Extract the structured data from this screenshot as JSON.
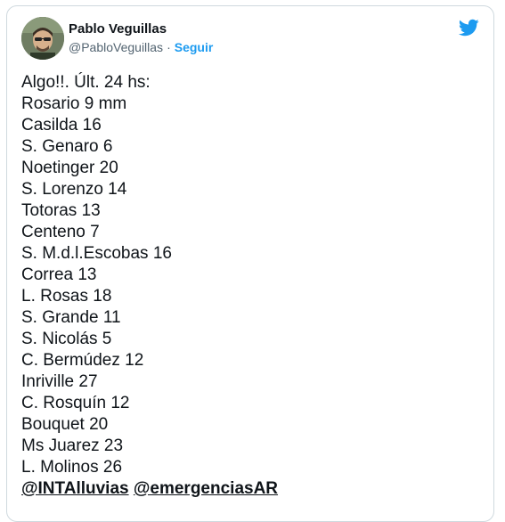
{
  "author": {
    "name": "Pablo Veguillas",
    "handle": "@PabloVeguillas",
    "separator": "·",
    "follow_label": "Seguir"
  },
  "icons": {
    "brand": "twitter-bird-icon",
    "brand_color": "#1d9bf0"
  },
  "tweet": {
    "lines": [
      "Algo!!. Últ. 24 hs:",
      "Rosario 9 mm",
      "Casilda 16",
      "S. Genaro 6",
      "Noetinger 20",
      "S. Lorenzo 14",
      "Totoras 13",
      "Centeno 7",
      "S. M.d.l.Escobas 16",
      "Correa 13",
      "L. Rosas 18",
      "S. Grande 11",
      "S. Nicolás 5",
      "C. Bermúdez 12",
      "Inriville 27",
      "C. Rosquín 12",
      "Bouquet 20",
      "Ms Juarez 23",
      "L. Molinos 26"
    ],
    "mentions": [
      "@INTAlluvias",
      "@emergenciasAR"
    ]
  }
}
